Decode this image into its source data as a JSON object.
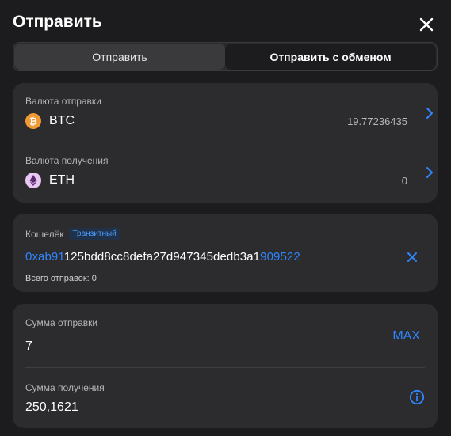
{
  "header": {
    "title": "Отправить"
  },
  "tabs": [
    {
      "label": "Отправить",
      "active": false
    },
    {
      "label": "Отправить с обменом",
      "active": true
    }
  ],
  "send_currency": {
    "label": "Валюта отправки",
    "coin": "BTC",
    "balance": "19.77236435",
    "icon": "bitcoin-icon"
  },
  "receive_currency": {
    "label": "Валюта получения",
    "coin": "ETH",
    "balance": "0",
    "icon": "ethereum-icon"
  },
  "wallet": {
    "label": "Кошелёк",
    "badge": "Транзитный",
    "address_prefix": "0xab91",
    "address_middle": "125bdd8cc8defa27d947345dedb3a1",
    "address_suffix": "909522",
    "sent_count": "Всего отправок: 0"
  },
  "amount": {
    "send_label": "Сумма отправки",
    "send_value": "7",
    "max_label": "MAX",
    "receive_label": "Сумма получения",
    "receive_value": "250,1621"
  },
  "colors": {
    "accent": "#2f86ff",
    "background": "#1c1c1e",
    "card": "#2c2c2e",
    "btc": "#f09a36",
    "eth": "#e8c7f3"
  }
}
